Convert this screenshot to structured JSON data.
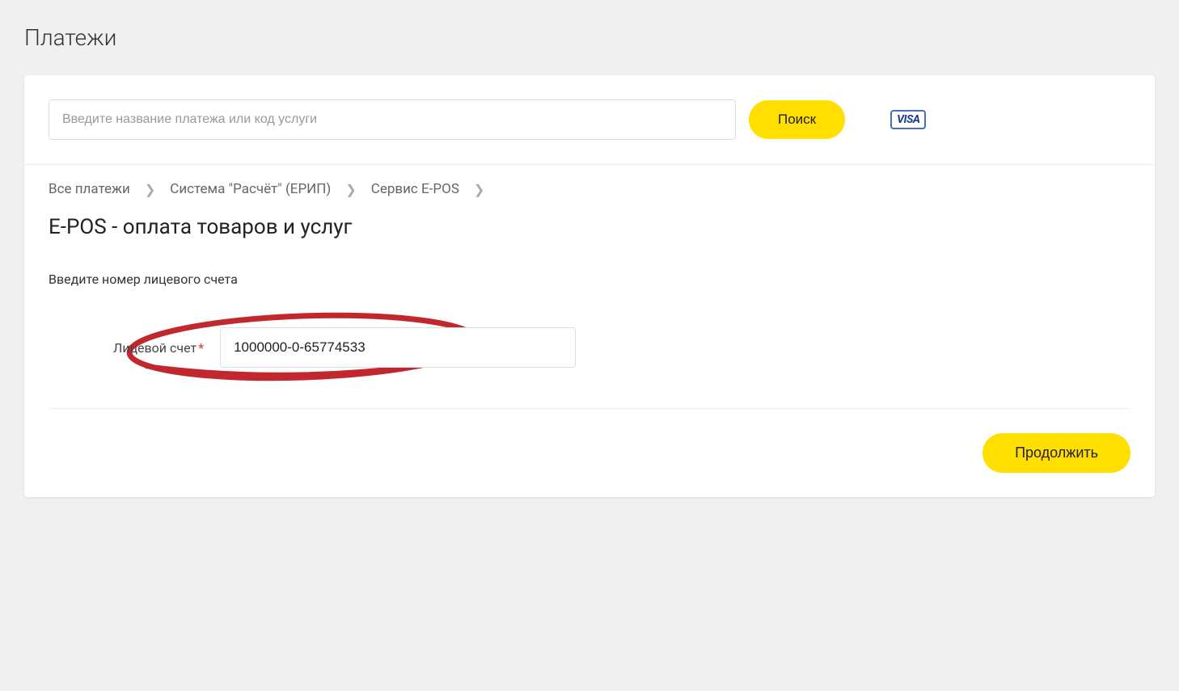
{
  "page": {
    "title": "Платежи"
  },
  "search": {
    "placeholder": "Введите название платежа или код услуги",
    "button_label": "Поиск",
    "card_badge": "VISA"
  },
  "breadcrumbs": {
    "items": [
      "Все платежи",
      "Система \"Расчёт\" (ЕРИП)",
      "Сервис E-POS"
    ]
  },
  "main": {
    "title": "E-POS - оплата товаров и услуг",
    "instruction": "Введите номер лицевого счета",
    "field_label": "Лицевой счет",
    "field_value": "1000000-0-65774533"
  },
  "footer": {
    "continue_label": "Продолжить"
  }
}
